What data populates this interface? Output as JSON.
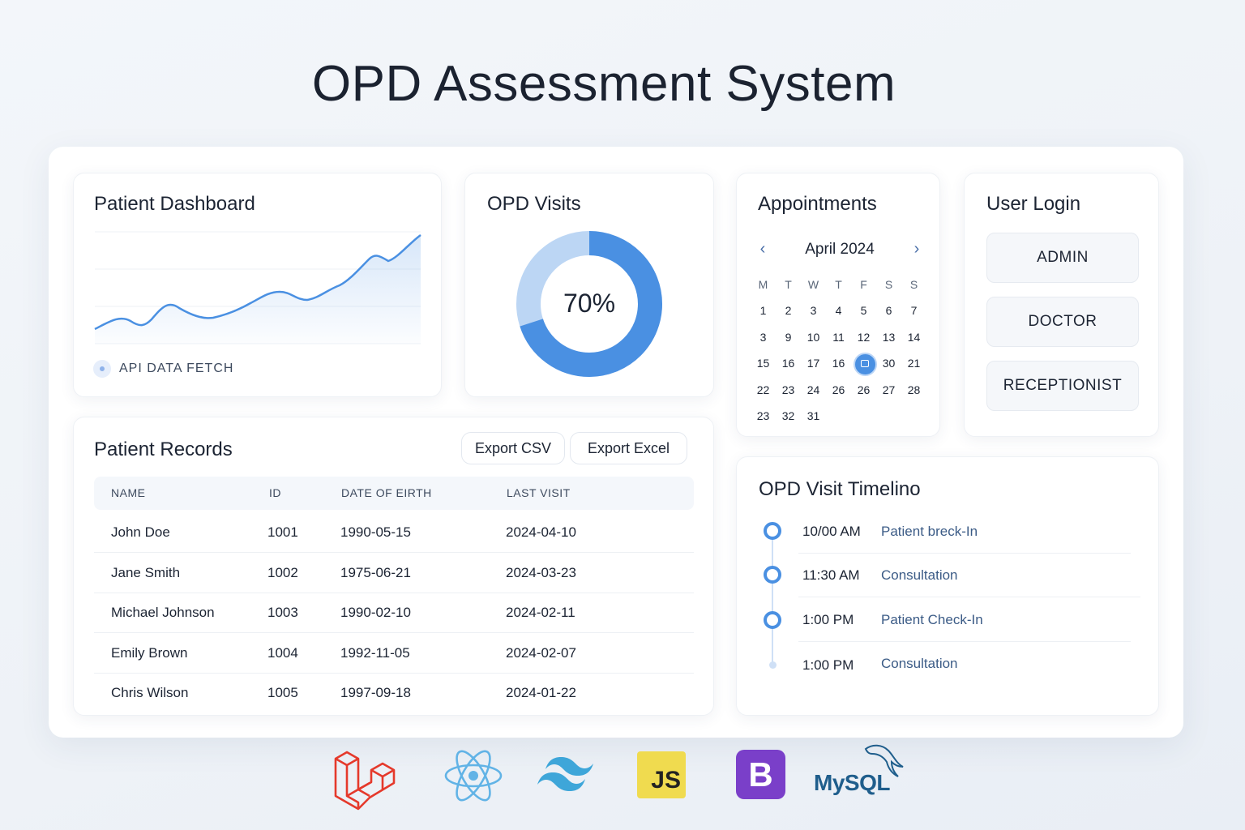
{
  "page": {
    "title": "OPD Assessment System"
  },
  "dashboard": {
    "title": "Patient Dashboard",
    "api_label": "API DATA FETCH"
  },
  "visits": {
    "title": "OPD Visits",
    "percent_label": "70%",
    "percent_value": 70,
    "colors": {
      "filled": "#4a90e2",
      "remaining": "#bcd6f4"
    }
  },
  "appointments": {
    "title": "Appointments",
    "month_label": "April 2024",
    "weekdays": [
      "M",
      "T",
      "W",
      "T",
      "F",
      "S",
      "S"
    ],
    "weeks": [
      [
        "1",
        "2",
        "3",
        "4",
        "5",
        "6",
        "7"
      ],
      [
        "3",
        "9",
        "10",
        "11",
        "12",
        "13",
        "14"
      ],
      [
        "15",
        "16",
        "17",
        "16",
        "",
        "30",
        "21"
      ],
      [
        "22",
        "23",
        "24",
        "26",
        "26",
        "27",
        "28"
      ],
      [
        "23",
        "32",
        "31",
        "",
        "",
        "",
        ""
      ]
    ],
    "selected": {
      "week": 2,
      "day": 4
    }
  },
  "login": {
    "title": "User Login",
    "roles": [
      "ADMIN",
      "DOCTOR",
      "RECEPTIONIST"
    ]
  },
  "records": {
    "title": "Patient Records",
    "export_csv": "Export CSV",
    "export_excel": "Export Excel",
    "columns": [
      "NAME",
      "ID",
      "DATE OF EIRTH",
      "LAST VISIT"
    ],
    "rows": [
      [
        "John Doe",
        "1001",
        "1990-05-15",
        "2024-04-10"
      ],
      [
        "Jane Smith",
        "1002",
        "1975-06-21",
        "2024-03-23"
      ],
      [
        "Michael Johnson",
        "1003",
        "1990-02-10",
        "2024-02-11"
      ],
      [
        "Emily Brown",
        "1004",
        "1992-11-05",
        "2024-02-07"
      ],
      [
        "Chris Wilson",
        "1005",
        "1997-09-18",
        "2024-01-22"
      ]
    ]
  },
  "timeline": {
    "title": "OPD Visit Timelino",
    "events": [
      {
        "time": "10/00 AM",
        "label": "Patient breck-In"
      },
      {
        "time": "11:30 AM",
        "label": "Consultation"
      },
      {
        "time": "1:00 PM",
        "label": "Patient Check-In"
      },
      {
        "time": "1:00 PM",
        "label": "Consultation"
      }
    ]
  },
  "tech_logos": {
    "items": [
      "laravel-icon",
      "react-icon",
      "tailwind-icon",
      "javascript-icon",
      "bootstrap-icon",
      "mysql-icon"
    ],
    "js_text": "JS",
    "bootstrap_text": "B",
    "mysql_text": "MySQL"
  },
  "colors": {
    "accent": "#4a90e2",
    "text": "#1c2433",
    "muted": "#3d4a5e",
    "laravel": "#e5392b",
    "react": "#61b3e6",
    "tailwind": "#3ea6d9",
    "js_bg": "#f0db4f",
    "bootstrap": "#7a3fc9",
    "mysql": "#1f5e8c"
  }
}
